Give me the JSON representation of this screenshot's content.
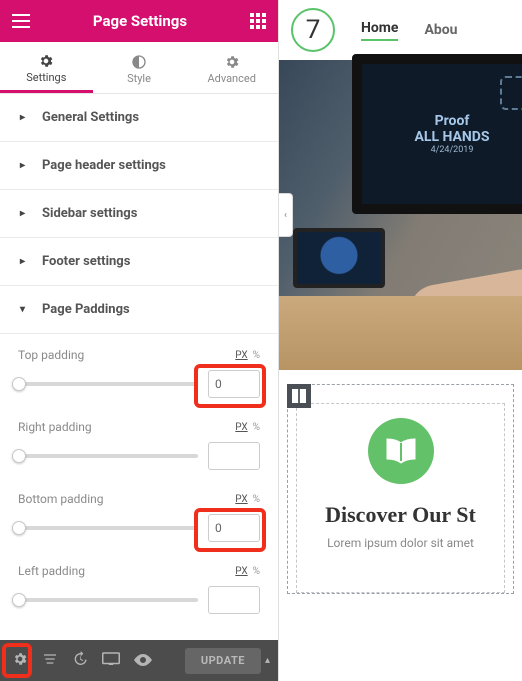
{
  "header": {
    "title": "Page Settings"
  },
  "tabs": {
    "settings": "Settings",
    "style": "Style",
    "advanced": "Advanced",
    "active": "settings"
  },
  "sections": {
    "general": {
      "label": "General Settings",
      "open": false
    },
    "pageHeader": {
      "label": "Page header settings",
      "open": false
    },
    "sidebar": {
      "label": "Sidebar settings",
      "open": false
    },
    "footer": {
      "label": "Footer settings",
      "open": false
    },
    "paddings": {
      "label": "Page Paddings",
      "open": true
    }
  },
  "paddings": {
    "units": {
      "active": "PX",
      "px": "PX",
      "pct": "%"
    },
    "top": {
      "label": "Top padding",
      "value": "0"
    },
    "right": {
      "label": "Right padding",
      "value": ""
    },
    "bottom": {
      "label": "Bottom padding",
      "value": "0"
    },
    "left": {
      "label": "Left padding",
      "value": ""
    }
  },
  "footerBar": {
    "update": "UPDATE"
  },
  "preview": {
    "logoNumber": "7",
    "nav": {
      "home": "Home",
      "about": "Abou"
    },
    "monitor": {
      "line1": "Proof",
      "line2": "ALL HANDS",
      "date": "4/24/2019"
    },
    "story": {
      "heading": "Discover Our St",
      "sub": "Lorem ipsum dolor sit amet"
    }
  }
}
